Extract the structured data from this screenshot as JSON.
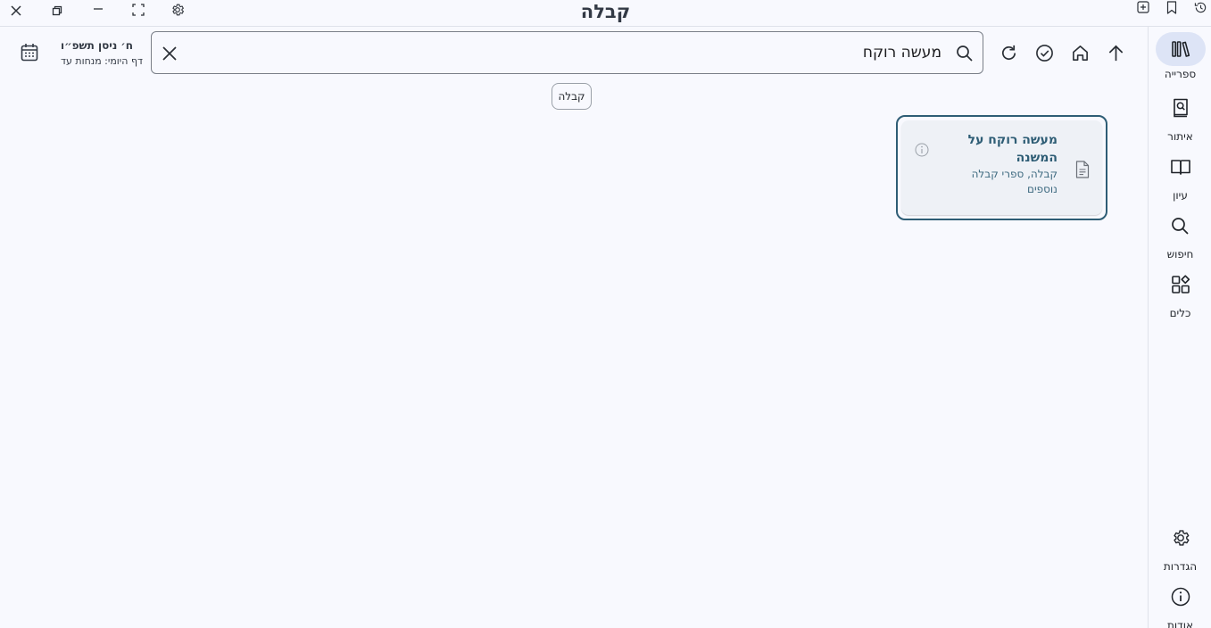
{
  "window": {
    "title": "קבלה"
  },
  "titlebar_icons": [
    "close-icon",
    "restore-icon",
    "minimize-icon",
    "fullscreen-icon",
    "settings-icon",
    "add-tab-icon",
    "bookmark-icon",
    "history-icon"
  ],
  "nav": {
    "items": [
      {
        "label": "ספרייה",
        "icon": "library-icon",
        "active": true
      },
      {
        "label": "איתור",
        "icon": "find-book-icon",
        "active": false
      },
      {
        "label": "עיון",
        "icon": "open-book-icon",
        "active": false
      },
      {
        "label": "חיפוש",
        "icon": "search-icon",
        "active": false
      },
      {
        "label": "כלים",
        "icon": "tools-icon",
        "active": false
      }
    ],
    "bottom_items": [
      {
        "label": "הגדרות",
        "icon": "settings-icon"
      },
      {
        "label": "אודות",
        "icon": "info-icon"
      }
    ]
  },
  "toolbar": {
    "icons": [
      "up-arrow-icon",
      "home-icon",
      "check-circle-icon",
      "refresh-icon"
    ]
  },
  "search": {
    "value": "מעשה רוקח",
    "placeholder": ""
  },
  "filter_chip": {
    "label": "קבלה"
  },
  "results": [
    {
      "title": "מעשה רוקח על המשנה",
      "subtitle": "קבלה, ספרי קבלה נוספים"
    }
  ],
  "daily": {
    "date": "ח׳ ניסן תשפ״ו",
    "daf": "דף היומי: מנחות עד"
  },
  "colors": {
    "background": "#f8f9fe",
    "accent": "#2e5d75",
    "rail_active": "#dde4f6"
  }
}
